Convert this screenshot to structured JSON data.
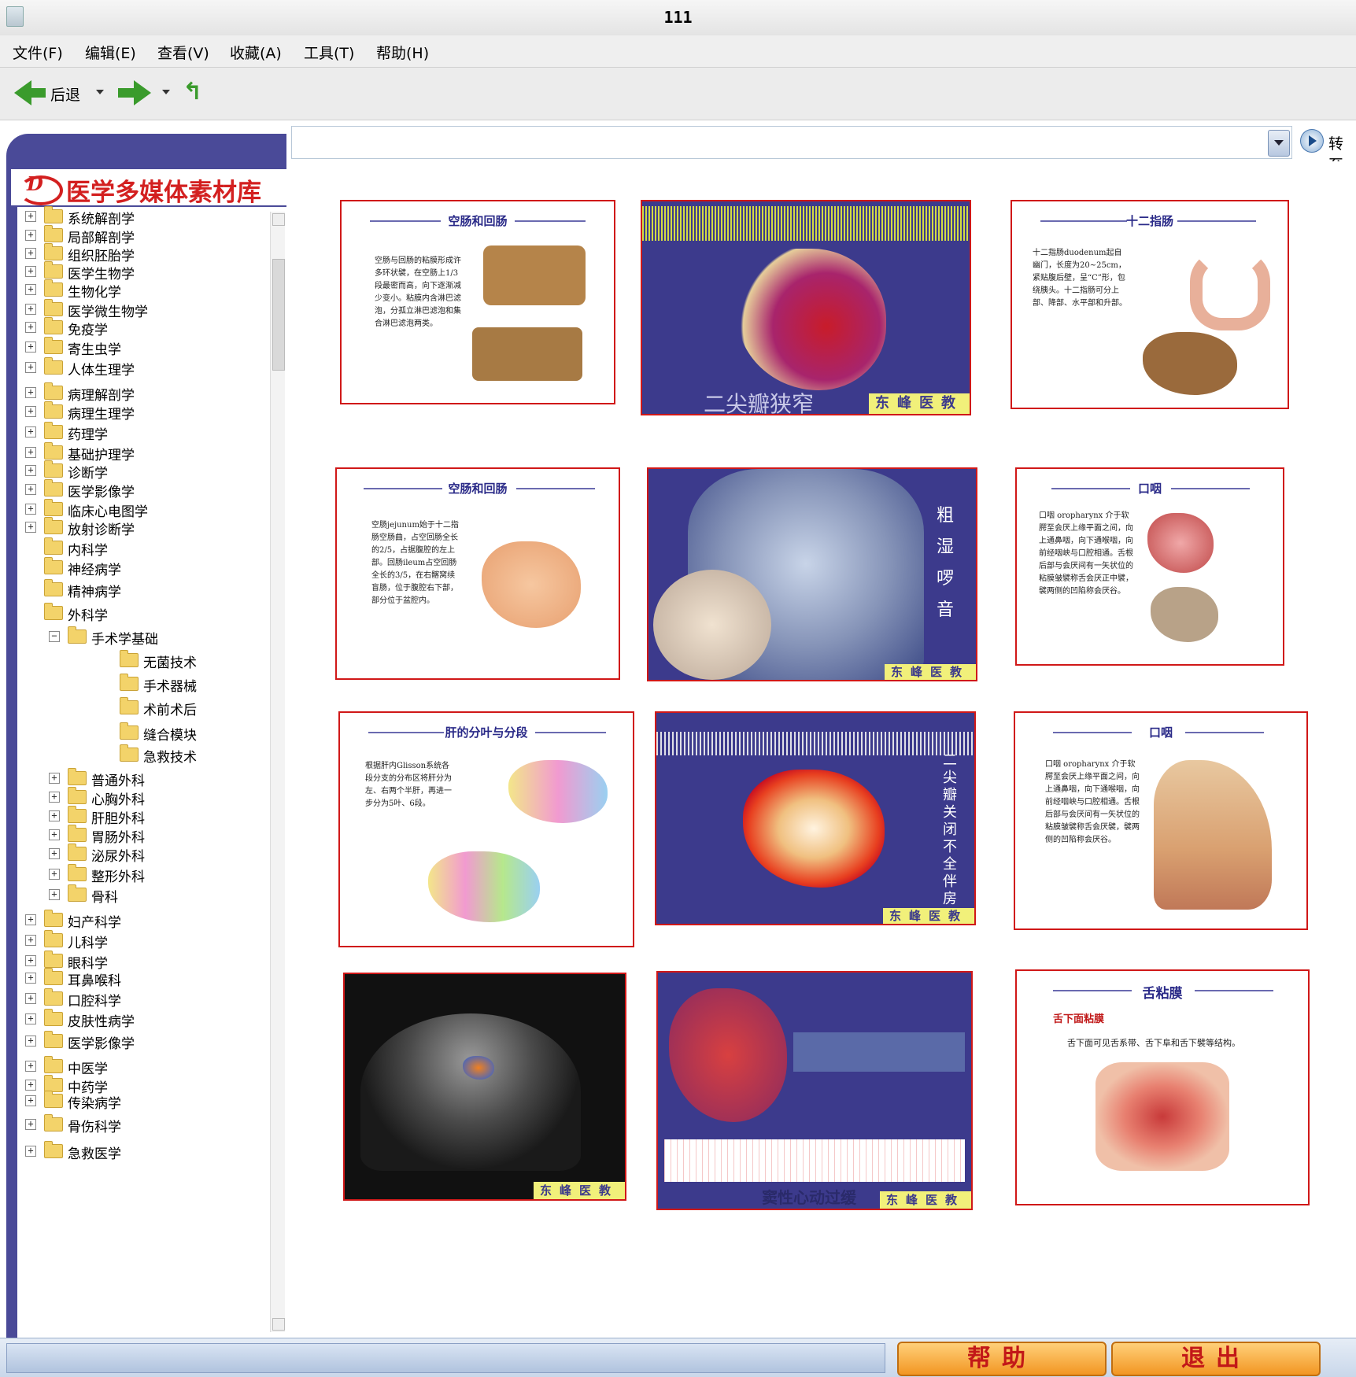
{
  "window": {
    "title": "111"
  },
  "menu": [
    {
      "label": "文件(F)",
      "name": "menu-file"
    },
    {
      "label": "编辑(E)",
      "name": "menu-edit"
    },
    {
      "label": "查看(V)",
      "name": "menu-view"
    },
    {
      "label": "收藏(A)",
      "name": "menu-favorites"
    },
    {
      "label": "工具(T)",
      "name": "menu-tools"
    },
    {
      "label": "帮助(H)",
      "name": "menu-help"
    }
  ],
  "toolbar": {
    "back_label": "后退",
    "go_label": "转至"
  },
  "address": {
    "value": ""
  },
  "sidebar": {
    "title": "医学多媒体素材库",
    "logo_text": "D",
    "items": [
      {
        "label": "系统解剖学",
        "level": 0,
        "exp": "+"
      },
      {
        "label": "局部解剖学",
        "level": 0,
        "exp": "+"
      },
      {
        "label": "组织胚胎学",
        "level": 0,
        "exp": "+"
      },
      {
        "label": "医学生物学",
        "level": 0,
        "exp": "+"
      },
      {
        "label": "生物化学",
        "level": 0,
        "exp": "+"
      },
      {
        "label": "医学微生物学",
        "level": 0,
        "exp": "+"
      },
      {
        "label": "免疫学",
        "level": 0,
        "exp": "+"
      },
      {
        "label": "寄生虫学",
        "level": 0,
        "exp": "+"
      },
      {
        "label": "人体生理学",
        "level": 0,
        "exp": "+"
      },
      {
        "label": "病理解剖学",
        "level": 0,
        "exp": "+"
      },
      {
        "label": "病理生理学",
        "level": 0,
        "exp": "+"
      },
      {
        "label": "药理学",
        "level": 0,
        "exp": "+"
      },
      {
        "label": "基础护理学",
        "level": 0,
        "exp": "+"
      },
      {
        "label": "诊断学",
        "level": 0,
        "exp": "+"
      },
      {
        "label": "医学影像学",
        "level": 0,
        "exp": "+"
      },
      {
        "label": "临床心电图学",
        "level": 0,
        "exp": "+"
      },
      {
        "label": "放射诊断学",
        "level": 0,
        "exp": "+"
      },
      {
        "label": "内科学",
        "level": 0,
        "exp": ""
      },
      {
        "label": "神经病学",
        "level": 0,
        "exp": ""
      },
      {
        "label": "精神病学",
        "level": 0,
        "exp": ""
      },
      {
        "label": "外科学",
        "level": 0,
        "exp": ""
      },
      {
        "label": "手术学基础",
        "level": 1,
        "exp": "−"
      },
      {
        "label": "无菌技术",
        "level": 2,
        "exp": ""
      },
      {
        "label": "手术器械",
        "level": 2,
        "exp": ""
      },
      {
        "label": "术前术后",
        "level": 2,
        "exp": ""
      },
      {
        "label": "缝合模块",
        "level": 2,
        "exp": ""
      },
      {
        "label": "急救技术",
        "level": 2,
        "exp": ""
      },
      {
        "label": "普通外科",
        "level": 1,
        "exp": "+"
      },
      {
        "label": "心胸外科",
        "level": 1,
        "exp": "+"
      },
      {
        "label": "肝胆外科",
        "level": 1,
        "exp": "+"
      },
      {
        "label": "胃肠外科",
        "level": 1,
        "exp": "+"
      },
      {
        "label": "泌尿外科",
        "level": 1,
        "exp": "+"
      },
      {
        "label": "整形外科",
        "level": 1,
        "exp": "+"
      },
      {
        "label": "骨科",
        "level": 1,
        "exp": "+"
      },
      {
        "label": "妇产科学",
        "level": 0,
        "exp": "+"
      },
      {
        "label": "儿科学",
        "level": 0,
        "exp": "+"
      },
      {
        "label": "眼科学",
        "level": 0,
        "exp": "+"
      },
      {
        "label": "耳鼻喉科",
        "level": 0,
        "exp": "+"
      },
      {
        "label": "口腔科学",
        "level": 0,
        "exp": "+"
      },
      {
        "label": "皮肤性病学",
        "level": 0,
        "exp": "+"
      },
      {
        "label": "医学影像学",
        "level": 0,
        "exp": "+"
      },
      {
        "label": "中医学",
        "level": 0,
        "exp": "+"
      },
      {
        "label": "中药学",
        "level": 0,
        "exp": "+"
      },
      {
        "label": "传染病学",
        "level": 0,
        "exp": "+"
      },
      {
        "label": "骨伤科学",
        "level": 0,
        "exp": "+"
      },
      {
        "label": "急救医学",
        "level": 0,
        "exp": "+"
      }
    ]
  },
  "thumbnails": [
    {
      "name": "thumb-jejunum-ileum",
      "title": "空肠和回肠",
      "text": "空肠与回肠的粘膜形成许多环状襞，在空肠上1/3段最密而高，向下逐渐减少变小。粘膜内含淋巴滤泡，分孤立淋巴滤泡和集合淋巴滤泡两类。"
    },
    {
      "name": "thumb-mitral-stenosis",
      "caption": "二尖瓣狭窄",
      "badge": "东峰医教"
    },
    {
      "name": "thumb-duodenum",
      "title": "十二指肠",
      "text": "十二指肠duodenum起自幽门，长度为20~25cm，紧贴腹后壁，呈“C”形，包绕胰头。十二指肠可分上部、降部、水平部和升部。"
    },
    {
      "name": "thumb-jejunum",
      "title": "空肠和回肠",
      "text": "空肠jejunum始于十二指肠空肠曲，占空回肠全长的2/5，占据腹腔的左上部。回肠ileum占空回肠全长的3/5，在右髂窝续盲肠，位于腹腔右下部，部分位于盆腔内。"
    },
    {
      "name": "thumb-coarse-rales",
      "caption": "粗湿啰音",
      "badge": "东峰医教"
    },
    {
      "name": "thumb-oropharynx-1",
      "title": "口咽",
      "text": "口咽 oropharynx 介于软腭至会厌上缘平面之间，向上通鼻咽，向下通喉咽，向前经咽峡与口腔相通。舌根后部与会厌间有一矢状位的粘膜皱襞称舌会厌正中襞，襞两侧的凹陷称会厌谷。"
    },
    {
      "name": "thumb-liver-segments",
      "title": "肝的分叶与分段",
      "text": "根据肝内Glisson系统各段分支的分布区将肝分为左、右两个半肝，再进一步分为5叶、6段。"
    },
    {
      "name": "thumb-mitral-regurg",
      "caption": "二尖瓣关闭不全伴房颤",
      "badge": "东峰医教"
    },
    {
      "name": "thumb-oropharynx-2",
      "title": "口咽",
      "text": "口咽 oropharynx 介于软腭至会厌上缘平面之间，向上通鼻咽，向下通喉咽，向前经咽峡与口腔相通。舌根后部与会厌间有一矢状位的粘膜皱襞称舌会厌襞，襞两侧的凹陷称会厌谷。"
    },
    {
      "name": "thumb-echo",
      "badge": "东峰医教"
    },
    {
      "name": "thumb-sinus-brady",
      "caption": "窦性心动过缓",
      "badge": "东峰医教"
    },
    {
      "name": "thumb-sublingual",
      "title": "舌粘膜",
      "subtitle": "舌下面粘膜",
      "text": "舌下面可见舌系带、舌下阜和舌下襞等结构。"
    }
  ],
  "buttons": {
    "help": "帮助",
    "exit": "退出"
  }
}
